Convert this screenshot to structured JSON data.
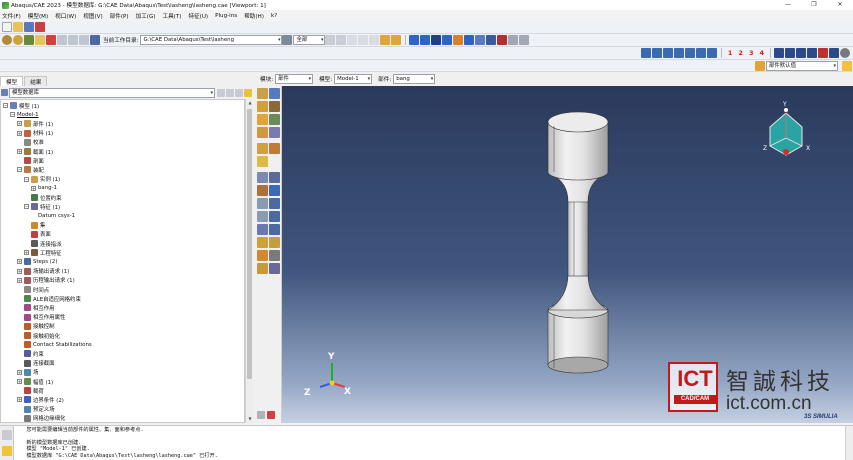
{
  "window": {
    "title": "Abaqus/CAE 2023 - 模型数据库: G:\\CAE Data\\Abaqus\\Test\\lasheng\\lasheng.cae [Viewport: 1]",
    "minimize": "—",
    "maximize": "❐",
    "close": "✕"
  },
  "menu": {
    "items": [
      "文件(F)",
      "模型(M)",
      "视口(W)",
      "视图(V)",
      "部件(P)",
      "加工(G)",
      "工具(T)",
      "特征(U)",
      "Plug-ins",
      "帮助(H)",
      "k?"
    ]
  },
  "toolbar": {
    "workdir_label": "当前工作目录:",
    "workdir_value": "G:\\CAE Data\\Abaqus\\Test\\lasheng",
    "selection_filter": "全部",
    "numbers": [
      "1",
      "2",
      "3",
      "4"
    ],
    "part_default": "部件默认值"
  },
  "tabs": [
    "模型",
    "结果"
  ],
  "tree_header": "模型数据库",
  "tree": [
    {
      "label": "模型 (1)",
      "level": 0,
      "exp": "⊟",
      "color": "#6a7fb6"
    },
    {
      "label": "Model-1",
      "level": 1,
      "exp": "⊟",
      "color": "",
      "underline": true
    },
    {
      "label": "部件 (1)",
      "level": 2,
      "exp": "⊞",
      "color": "#c9a04a"
    },
    {
      "label": "材料 (1)",
      "level": 2,
      "exp": "⊞",
      "color": "#c0623b"
    },
    {
      "label": "校准",
      "level": 2,
      "exp": "",
      "color": "#888"
    },
    {
      "label": "截面 (1)",
      "level": 2,
      "exp": "⊞",
      "color": "#9a7a3a"
    },
    {
      "label": "剖面",
      "level": 2,
      "exp": "",
      "color": "#b34a4a"
    },
    {
      "label": "装配",
      "level": 2,
      "exp": "⊟",
      "color": "#b37a3a"
    },
    {
      "label": "实例 (1)",
      "level": 3,
      "exp": "⊟",
      "color": "#c9a04a"
    },
    {
      "label": "bang-1",
      "level": 4,
      "exp": "⊞",
      "color": ""
    },
    {
      "label": "位置约束",
      "level": 3,
      "exp": "",
      "color": "#4a7a4a"
    },
    {
      "label": "特征 (1)",
      "level": 3,
      "exp": "⊟",
      "color": "#6a6a9a"
    },
    {
      "label": "Datum csys-1",
      "level": 4,
      "exp": "",
      "color": ""
    },
    {
      "label": "集",
      "level": 3,
      "exp": "",
      "color": "#c98a2a"
    },
    {
      "label": "表面",
      "level": 3,
      "exp": "",
      "color": "#c04040"
    },
    {
      "label": "连接指派",
      "level": 3,
      "exp": "",
      "color": "#5a5a5a"
    },
    {
      "label": "工程特征",
      "level": 3,
      "exp": "⊞",
      "color": "#7a5a3a"
    },
    {
      "label": "Steps (2)",
      "level": 2,
      "exp": "⊞",
      "color": "#4a6aa0"
    },
    {
      "label": "场输出请求 (1)",
      "level": 2,
      "exp": "⊞",
      "color": "#a05a5a"
    },
    {
      "label": "历程输出请求 (1)",
      "level": 2,
      "exp": "⊞",
      "color": "#a05a5a"
    },
    {
      "label": "时间点",
      "level": 2,
      "exp": "",
      "color": "#8a8a8a"
    },
    {
      "label": "ALE自适应网格约束",
      "level": 2,
      "exp": "",
      "color": "#4a8a4a"
    },
    {
      "label": "相互作用",
      "level": 2,
      "exp": "",
      "color": "#a04a8a"
    },
    {
      "label": "相互作用属性",
      "level": 2,
      "exp": "",
      "color": "#a04a8a"
    },
    {
      "label": "接触控制",
      "level": 2,
      "exp": "",
      "color": "#c05a2a"
    },
    {
      "label": "接触初始化",
      "level": 2,
      "exp": "",
      "color": "#c05a2a"
    },
    {
      "label": "Contact Stabilizations",
      "level": 2,
      "exp": "",
      "color": "#c05a2a"
    },
    {
      "label": "约束",
      "level": 2,
      "exp": "",
      "color": "#5a5aa0"
    },
    {
      "label": "连接截面",
      "level": 2,
      "exp": "",
      "color": "#5a5a5a"
    },
    {
      "label": "场",
      "level": 2,
      "exp": "⊞",
      "color": "#4a8ab0"
    },
    {
      "label": "幅值 (1)",
      "level": 2,
      "exp": "⊞",
      "color": "#6a8a4a"
    },
    {
      "label": "载荷",
      "level": 2,
      "exp": "",
      "color": "#c04040"
    },
    {
      "label": "边界条件 (2)",
      "level": 2,
      "exp": "⊞",
      "color": "#4060c0"
    },
    {
      "label": "预定义场",
      "level": 2,
      "exp": "",
      "color": "#4a8ab0"
    },
    {
      "label": "网格边缘细化",
      "level": 2,
      "exp": "",
      "color": "#7a7a7a"
    }
  ],
  "module": {
    "module_label": "模块:",
    "module_value": "部件",
    "model_label": "模型:",
    "model_value": "Model-1",
    "part_label": "部件:",
    "part_value": "bang"
  },
  "triad": {
    "y": "Y",
    "x": "X",
    "z": "Z"
  },
  "view_cube": {
    "y": "Y",
    "x": "X",
    "z": "Z"
  },
  "messages": {
    "text": "   您可能需要编辑当前部件的属性、集、面和参考点.\n\n   新的模型数据库已创建.\n   模型 \"Model-1\" 已创建.\n   模型数据库 \"G:\\CAE Data\\Abaqus\\Test\\lasheng\\lasheng.cae\" 已打开."
  },
  "watermark": {
    "logo": "ICT",
    "logo_sub": "CAD/CAM",
    "name": "智誠科技",
    "url": "ict.com.cn"
  },
  "brand": "3S SIMULIA",
  "colors": {
    "viewport_top": "#2a3a5c",
    "viewport_bottom": "#c5d0e2",
    "watermark_red": "#c4191b"
  }
}
